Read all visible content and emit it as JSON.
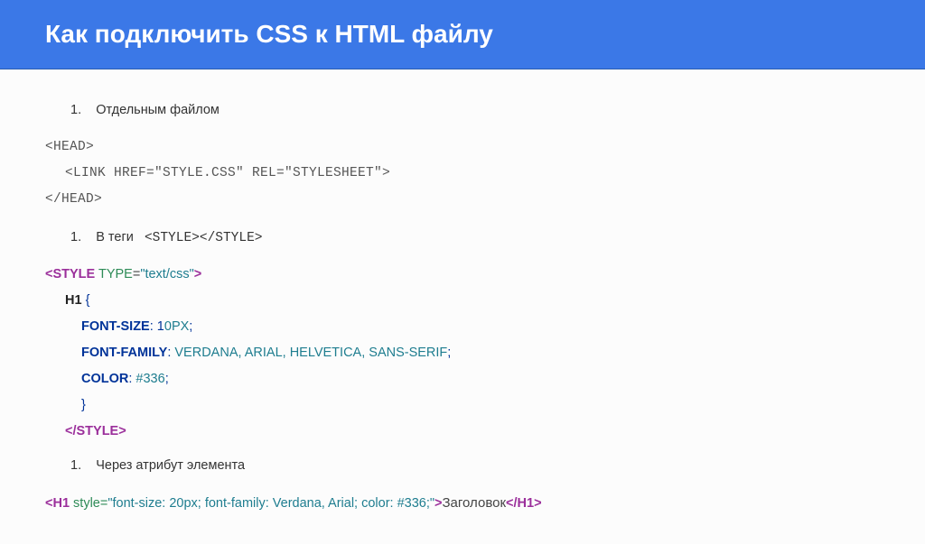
{
  "header": {
    "title": "Как подключить CSS к HTML файлу"
  },
  "section1": {
    "number": "1.",
    "label": "Отдельным файлом",
    "code_open": "<HEAD>",
    "code_link": "<LINK HREF=\"STYLE.CSS\" REL=\"STYLESHEET\">",
    "code_close": "</HEAD>"
  },
  "section2": {
    "number": "1.",
    "label": "В теги",
    "inline_tags": "<STYLE></STYLE>",
    "code": {
      "open_tag": "<STYLE",
      "attr_name": " TYPE",
      "eq": "=",
      "attr_val": "\"text/css\"",
      "open_end": ">",
      "selector": "H1",
      "brace_open": " {",
      "p1_name": "FONT-SIZE",
      "p1_colon": ": ",
      "p1_v1": "1",
      "p1_v2": "0PX",
      "semi": ";",
      "p2_name": "FONT-FAMILY",
      "p2_val": "VERDANA, ARIAL, HELVETICA, SANS-SERIF",
      "p3_name": "COLOR",
      "p3_val": "#336",
      "brace_close": "}",
      "close_tag": "</STYLE>"
    }
  },
  "section3": {
    "number": "1.",
    "label": "Через атрибут элемента",
    "code": {
      "open": "<H1",
      "attr": " style=",
      "val": "\"font-size: 20px; font-family: Verdana, Arial; color: #336;\"",
      "gt": ">",
      "text": "Заголовок",
      "close": "</H1>"
    }
  }
}
